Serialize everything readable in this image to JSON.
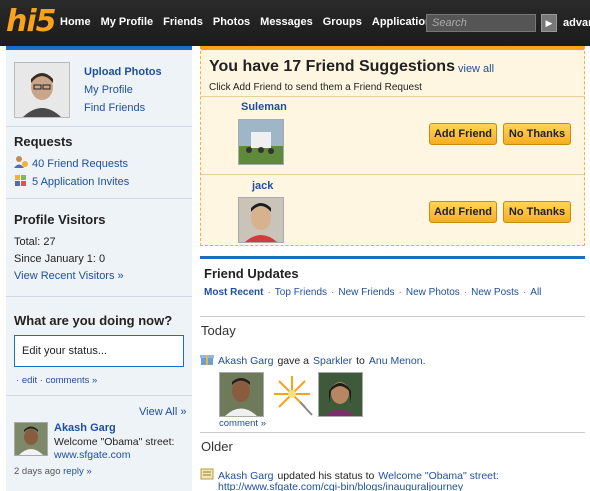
{
  "header": {
    "logo": "hi5",
    "nav": [
      "Home",
      "My Profile",
      "Friends",
      "Photos",
      "Messages",
      "Groups",
      "Applications"
    ],
    "search_placeholder": "Search",
    "advanced": "advan"
  },
  "sidebar": {
    "profile_links": [
      "Upload Photos",
      "My Profile",
      "Find Friends"
    ],
    "requests": {
      "title": "Requests",
      "friend_requests": "40 Friend Requests",
      "app_invites": "5 Application Invites"
    },
    "visitors": {
      "title": "Profile Visitors",
      "total": "Total: 27",
      "since": "Since January 1: 0",
      "view_recent": "View Recent Visitors »"
    },
    "status": {
      "title": "What are you doing now?",
      "placeholder": "Edit your status...",
      "edit": "edit",
      "comments": "comments »"
    },
    "view_all": "View All »",
    "friend_status": {
      "name": "Akash Garg",
      "text": "Welcome \"Obama\" street:",
      "link": "www.sfgate.com",
      "ago": "2 days ago",
      "reply": "reply »"
    }
  },
  "suggestions": {
    "title": "You have 17 Friend Suggestions",
    "view_all": "view all",
    "subtitle": "Click Add Friend to send them a Friend Request",
    "people": [
      {
        "name": "Suleman"
      },
      {
        "name": "jack"
      }
    ],
    "add_label": "Add Friend",
    "no_label": "No Thanks"
  },
  "updates": {
    "title": "Friend Updates",
    "filters": [
      "Most Recent",
      "Top Friends",
      "New Friends",
      "New Photos",
      "New Posts",
      "All"
    ],
    "today_label": "Today",
    "gift": {
      "actor": "Akash Garg",
      "verb": "gave a",
      "item": "Sparkler",
      "to": "to",
      "recipient": "Anu Menon."
    },
    "comment": "comment »",
    "older_label": "Older",
    "older": {
      "actor": "Akash Garg",
      "verb": "updated his status to",
      "status": "Welcome \"Obama\" street:",
      "url": "http://www.sfgate.com/cgi-bin/blogs/inauguraljourney"
    }
  },
  "colors": {
    "accent_blue": "#1a6fc4",
    "brand_orange": "#f7a21c",
    "link": "#1f4f9c"
  }
}
